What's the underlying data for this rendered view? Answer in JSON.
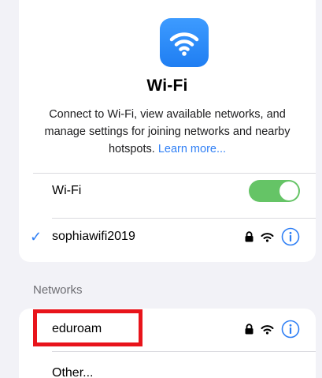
{
  "header": {
    "title": "Wi-Fi",
    "description_text": "Connect to Wi-Fi, view available networks, and manage settings for joining networks and nearby hotspots.",
    "learn_more_link": "Learn more..."
  },
  "wifi_toggle": {
    "label": "Wi-Fi",
    "enabled": true
  },
  "connected_network": {
    "name": "sophiawifi2019",
    "secured": true
  },
  "networks_section": {
    "header": "Networks",
    "items": [
      {
        "name": "eduroam",
        "secured": true,
        "highlighted": true
      },
      {
        "name": "Other..."
      }
    ]
  },
  "colors": {
    "background": "#f2f2f7",
    "card": "#ffffff",
    "accent_blue": "#2f7ff5",
    "toggle_green": "#65c466",
    "highlight_red": "#e8141b"
  },
  "icons": {
    "app_icon": "wifi-icon",
    "lock": "lock-icon",
    "signal": "wifi-signal-icon",
    "info": "info-icon",
    "check": "checkmark-icon"
  }
}
